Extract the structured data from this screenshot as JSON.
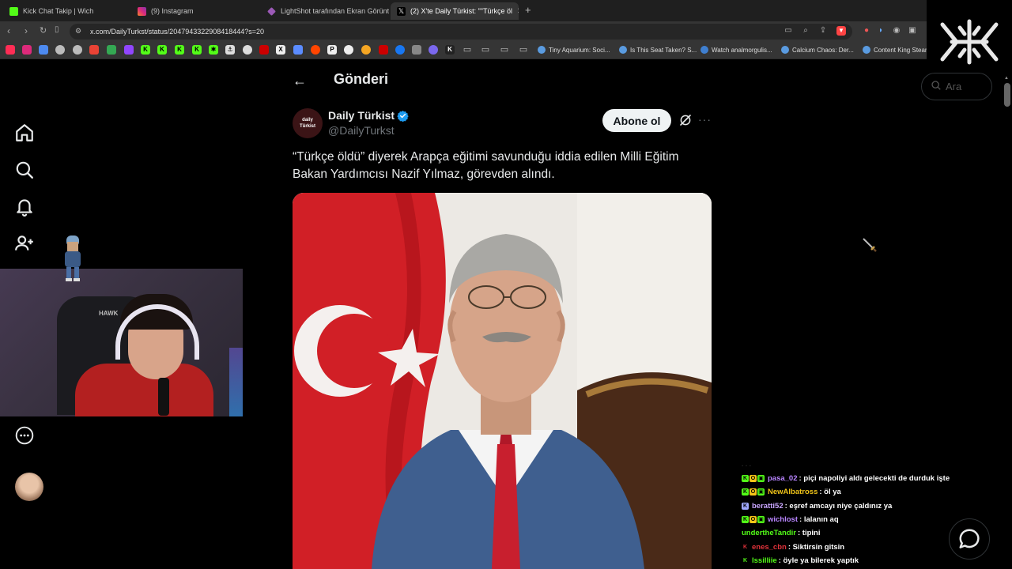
{
  "browser": {
    "tabs": [
      {
        "title": "Kick Chat Takip | Wich",
        "favicon_color": "#53fc18"
      },
      {
        "title": "(9) Instagram",
        "favicon_color": "#e1306c"
      },
      {
        "title": "LightShot tarafından Ekran Görüntüsü",
        "favicon_color": "#9b59b6"
      },
      {
        "title": "(2) X'te Daily Türkist: \"\"Türkçe öl",
        "favicon_color": "#ffffff"
      }
    ],
    "new_tab": "+",
    "url": "x.com/DailyTurkst/status/2047943322908418444?s=20",
    "bookmarks": [
      {
        "title": "Tiny Aquarium: Soci...",
        "color": "#5a9be0"
      },
      {
        "title": "Is This Seat Taken? S...",
        "color": "#5a9be0"
      },
      {
        "title": "Watch analmorgulis...",
        "color": "#3f7fd0"
      },
      {
        "title": "Calcium Chaos: Der...",
        "color": "#5a9be0"
      },
      {
        "title": "Content King Steam",
        "color": "#5a9be0"
      }
    ]
  },
  "x": {
    "header_title": "Gönderi",
    "author_name": "Daily Türkist",
    "author_handle": "@DailyTurkst",
    "avatar_text_1": "daily",
    "avatar_text_2": "Türkist",
    "follow_label": "Abone ol",
    "post_text": "“Türkçe öldü” diyerek Arapça eğitimi savunduğu iddia edilen Milli Eğitim Bakan Yardımcısı Nazif Yılmaz, görevden alındı.",
    "search_placeholder": "Ara"
  },
  "webcam": {
    "chair_brand": "HAWK"
  },
  "chat": [
    {
      "user": "pasa_02",
      "color": "#b985ff",
      "badges": [
        "K",
        "O",
        "gift"
      ],
      "message": "piçi napoliyi aldı gelecekti de durduk işte"
    },
    {
      "user": "NewAlbatross",
      "color": "#f0c419",
      "badges": [
        "K",
        "O",
        "gift"
      ],
      "message": "öl ya"
    },
    {
      "user": "beratti52",
      "color": "#c9a6ff",
      "badges": [
        "K"
      ],
      "message": "eşref amcayı niye çaldınız ya"
    },
    {
      "user": "wichlost",
      "color": "#b985ff",
      "badges": [
        "K",
        "O",
        "gift"
      ],
      "message": "lalanın aq"
    },
    {
      "user": "undertheTandir",
      "color": "#53fc18",
      "badges": [],
      "message": "tipini"
    },
    {
      "user": "enes_cbn",
      "color": "#e0323a",
      "badges": [
        "K"
      ],
      "message": "Siktirsin gitsin"
    },
    {
      "user": "lssilliie",
      "color": "#53fc18",
      "badges": [
        "K"
      ],
      "message": "öyle ya bilerek yaptık"
    }
  ]
}
